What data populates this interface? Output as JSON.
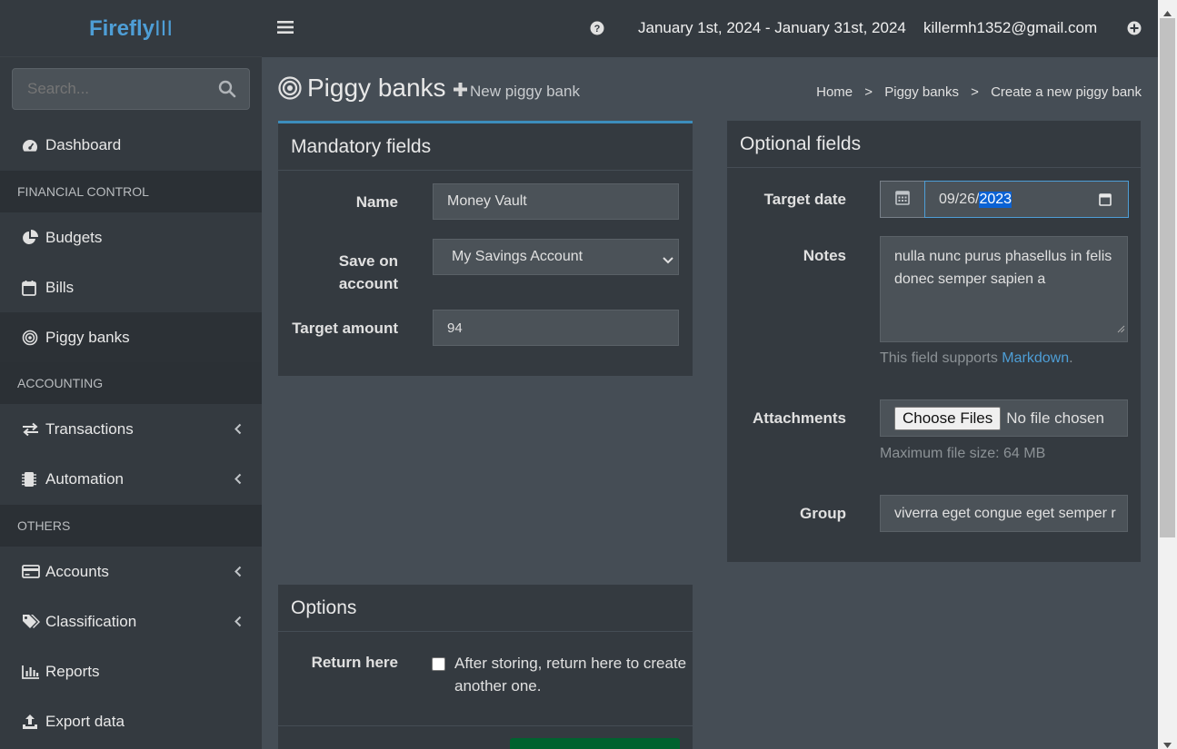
{
  "app": {
    "brand_a": "Firefly",
    "brand_b": "III"
  },
  "search": {
    "placeholder": "Search..."
  },
  "sidebar": {
    "dashboard": "Dashboard",
    "sec_financial": "FINANCIAL CONTROL",
    "budgets": "Budgets",
    "bills": "Bills",
    "piggy": "Piggy banks",
    "sec_accounting": "ACCOUNTING",
    "transactions": "Transactions",
    "automation": "Automation",
    "sec_others": "OTHERS",
    "accounts": "Accounts",
    "classification": "Classification",
    "reports": "Reports",
    "export": "Export data"
  },
  "topbar": {
    "date_range": "January 1st, 2024 - January 31st, 2024",
    "user": "killermh1352@gmail.com"
  },
  "page": {
    "title": "Piggy banks",
    "new_link": "New piggy bank"
  },
  "breadcrumb": {
    "home": "Home",
    "sep": ">",
    "piggy": "Piggy banks",
    "current": "Create a new piggy bank"
  },
  "mandatory": {
    "title": "Mandatory fields",
    "name_label": "Name",
    "name_value": "Money Vault",
    "account_label_1": "Save on",
    "account_label_2": "account",
    "account_value": "My Savings Account",
    "amount_label": "Target amount",
    "amount_value": "94"
  },
  "optional": {
    "title": "Optional fields",
    "date_label": "Target date",
    "date_mm": "09/26/",
    "date_yyyy": "2023",
    "notes_label": "Notes",
    "notes_value": "nulla nunc purus phasellus in felis donec semper sapien a",
    "notes_help_prefix": "This field supports ",
    "notes_help_link": "Markdown",
    "notes_help_suffix": ".",
    "attach_label": "Attachments",
    "attach_button": "Choose Files",
    "attach_status": "No file chosen",
    "attach_help": "Maximum file size: 64 MB",
    "group_label": "Group",
    "group_value": "viverra eget congue eget semper r"
  },
  "options": {
    "title": "Options",
    "return_label": "Return here",
    "return_text_1": "After storing, return here to create",
    "return_text_2": "another one."
  }
}
